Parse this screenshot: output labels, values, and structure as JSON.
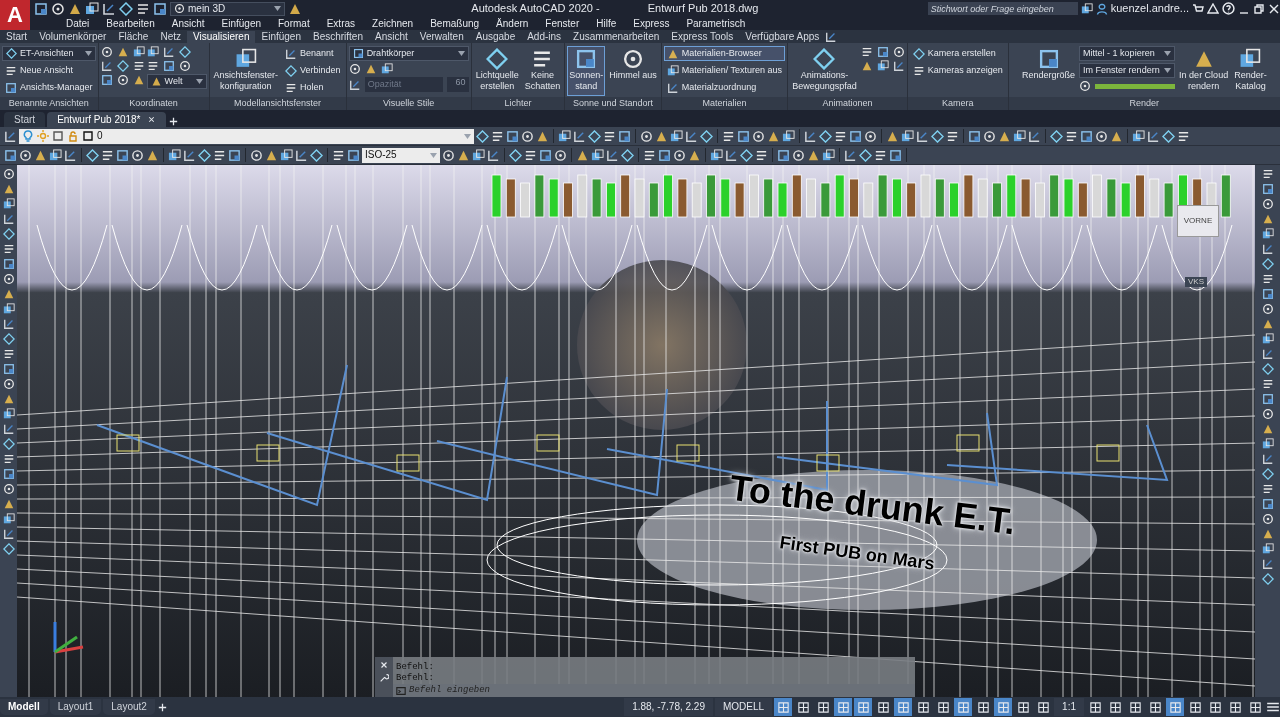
{
  "app": {
    "logo": "A",
    "workspace": "mein 3D",
    "title": "Autodesk AutoCAD 2020 -",
    "file": "Entwurf Pub 2018.dwg",
    "search_placeholder": "Stichwort oder Frage eingeben",
    "user": "kuenzel.andre..."
  },
  "menu": [
    "Datei",
    "Bearbeiten",
    "Ansicht",
    "Einfügen",
    "Format",
    "Extras",
    "Zeichnen",
    "Bemaßung",
    "Ändern",
    "Fenster",
    "Hilfe",
    "Express",
    "Parametrisch"
  ],
  "ribbon_tabs": [
    {
      "label": "Start",
      "selected": false
    },
    {
      "label": "Volumenkörper",
      "selected": false
    },
    {
      "label": "Fläche",
      "selected": false
    },
    {
      "label": "Netz",
      "selected": false
    },
    {
      "label": "Visualisieren",
      "selected": true
    },
    {
      "label": "Einfügen",
      "selected": false
    },
    {
      "label": "Beschriften",
      "selected": false
    },
    {
      "label": "Ansicht",
      "selected": false
    },
    {
      "label": "Verwalten",
      "selected": false
    },
    {
      "label": "Ausgabe",
      "selected": false
    },
    {
      "label": "Add-ins",
      "selected": false
    },
    {
      "label": "Zusammenarbeiten",
      "selected": false
    },
    {
      "label": "Express Tools",
      "selected": false
    },
    {
      "label": "Verfügbare Apps",
      "selected": false
    }
  ],
  "ribbon_panels": [
    {
      "title": "Benannte Ansichten",
      "columns": [
        [
          {
            "kind": "dropdown",
            "value": "ET-Ansichten",
            "with_icon": true
          },
          {
            "kind": "small",
            "label": "Neue Ansicht",
            "active": false
          },
          {
            "kind": "small",
            "label": "Ansichts-Manager",
            "active": false
          }
        ]
      ]
    },
    {
      "title": "Koordinaten",
      "columns": [
        [
          {
            "kind": "icons"
          },
          {
            "kind": "icons"
          },
          {
            "kind": "icons"
          }
        ],
        [
          {
            "kind": "icons"
          },
          {
            "kind": "icons"
          },
          {
            "kind": "dropdown",
            "value": "Welt",
            "with_icon": true
          }
        ]
      ]
    },
    {
      "title": "Modellansichtsfenster",
      "columns": [
        [
          {
            "kind": "large",
            "lines": [
              "Ansichtsfenster-",
              "konfiguration"
            ],
            "active": false
          }
        ],
        [
          {
            "kind": "small",
            "label": "Benannt",
            "active": false
          },
          {
            "kind": "small",
            "label": "Verbinden",
            "active": false
          },
          {
            "kind": "small",
            "label": "Holen",
            "active": false
          }
        ]
      ]
    },
    {
      "title": "Visuelle Stile",
      "columns": [
        [
          {
            "kind": "dropdown",
            "value": "Drahtkörper",
            "with_icon": true
          },
          {
            "kind": "icons"
          },
          {
            "kind": "slider",
            "placeholder": "Opazität",
            "value": "60",
            "disabled": true
          }
        ]
      ]
    },
    {
      "title": "Lichter",
      "columns": [
        [
          {
            "kind": "large",
            "lines": [
              "Lichtquelle",
              "erstellen"
            ],
            "active": false
          }
        ],
        [
          {
            "kind": "large",
            "lines": [
              "Keine",
              "Schatten"
            ],
            "active": false
          }
        ]
      ]
    },
    {
      "title": "Sonne und Standort",
      "columns": [
        [
          {
            "kind": "large",
            "lines": [
              "Sonnen-",
              "stand"
            ],
            "active": true
          }
        ],
        [
          {
            "kind": "large",
            "lines": [
              "Himmel aus"
            ],
            "active": false
          }
        ]
      ]
    },
    {
      "title": "Materialien",
      "columns": [
        [
          {
            "kind": "small",
            "label": "Materialien-Browser",
            "active": true
          },
          {
            "kind": "small",
            "label": "Materialien/ Texturen aus",
            "active": false
          },
          {
            "kind": "small",
            "label": "Materialzuordnung",
            "active": false
          }
        ]
      ]
    },
    {
      "title": "Animationen",
      "columns": [
        [
          {
            "kind": "large",
            "lines": [
              "Animations-",
              "Bewegungspfad"
            ],
            "active": false
          }
        ],
        [
          {
            "kind": "icons"
          },
          {
            "kind": "icons"
          }
        ]
      ]
    },
    {
      "title": "Kamera",
      "columns": [
        [
          {
            "kind": "small",
            "label": "Kamera erstellen",
            "active": false
          },
          {
            "kind": "small",
            "label": "Kameras anzeigen",
            "active": false
          }
        ]
      ]
    },
    {
      "title": "Render",
      "columns": [
        [
          {
            "kind": "large",
            "lines": [
              "Rendergröße"
            ],
            "active": false
          }
        ],
        [
          {
            "kind": "dropdown",
            "value": "Mittel - 1 kopieren",
            "with_icon": false
          },
          {
            "kind": "dropdown",
            "value": "Im Fenster rendern",
            "with_icon": false
          },
          {
            "kind": "meter",
            "level": 1
          }
        ],
        [
          {
            "kind": "large",
            "lines": [
              "In der Cloud",
              "rendern"
            ],
            "active": false
          }
        ],
        [
          {
            "kind": "large",
            "lines": [
              "Render-",
              "Katalog"
            ],
            "active": false
          }
        ]
      ]
    }
  ],
  "doc_tabs": [
    {
      "label": "Start",
      "selected": false
    },
    {
      "label": "Entwurf Pub 2018*",
      "selected": true
    }
  ],
  "layer": {
    "value": "0"
  },
  "dimstyle": {
    "value": "ISO-25"
  },
  "viewport": {
    "viewcube_face": "VORNE",
    "ucs_label": "VKS",
    "model_texts": [
      "To the drunk E.T.",
      "First PUB on Mars"
    ]
  },
  "command_line": {
    "history": [
      "Befehl:",
      "Befehl:"
    ],
    "placeholder": "Befehl eingeben"
  },
  "layout_tabs": [
    {
      "label": "Modell",
      "selected": true
    },
    {
      "label": "Layout1",
      "selected": false
    },
    {
      "label": "Layout2",
      "selected": false
    }
  ],
  "status_bar": {
    "coordinates": "1.88, -7.78, 2.29",
    "space": "MODELL",
    "scale": "1:1",
    "toggles": [
      {
        "on": true
      },
      {
        "on": false
      },
      {
        "on": false
      },
      {
        "on": true
      },
      {
        "on": true
      },
      {
        "on": false
      },
      {
        "on": true
      },
      {
        "on": false
      },
      {
        "on": false
      },
      {
        "on": true
      },
      {
        "on": false
      },
      {
        "on": true
      },
      {
        "on": false
      },
      {
        "on": false
      }
    ],
    "tail_toggles": [
      {
        "on": false
      },
      {
        "on": false
      },
      {
        "on": false
      },
      {
        "on": false
      },
      {
        "on": true
      },
      {
        "on": false
      },
      {
        "on": false
      },
      {
        "on": false
      },
      {
        "on": false
      }
    ]
  }
}
